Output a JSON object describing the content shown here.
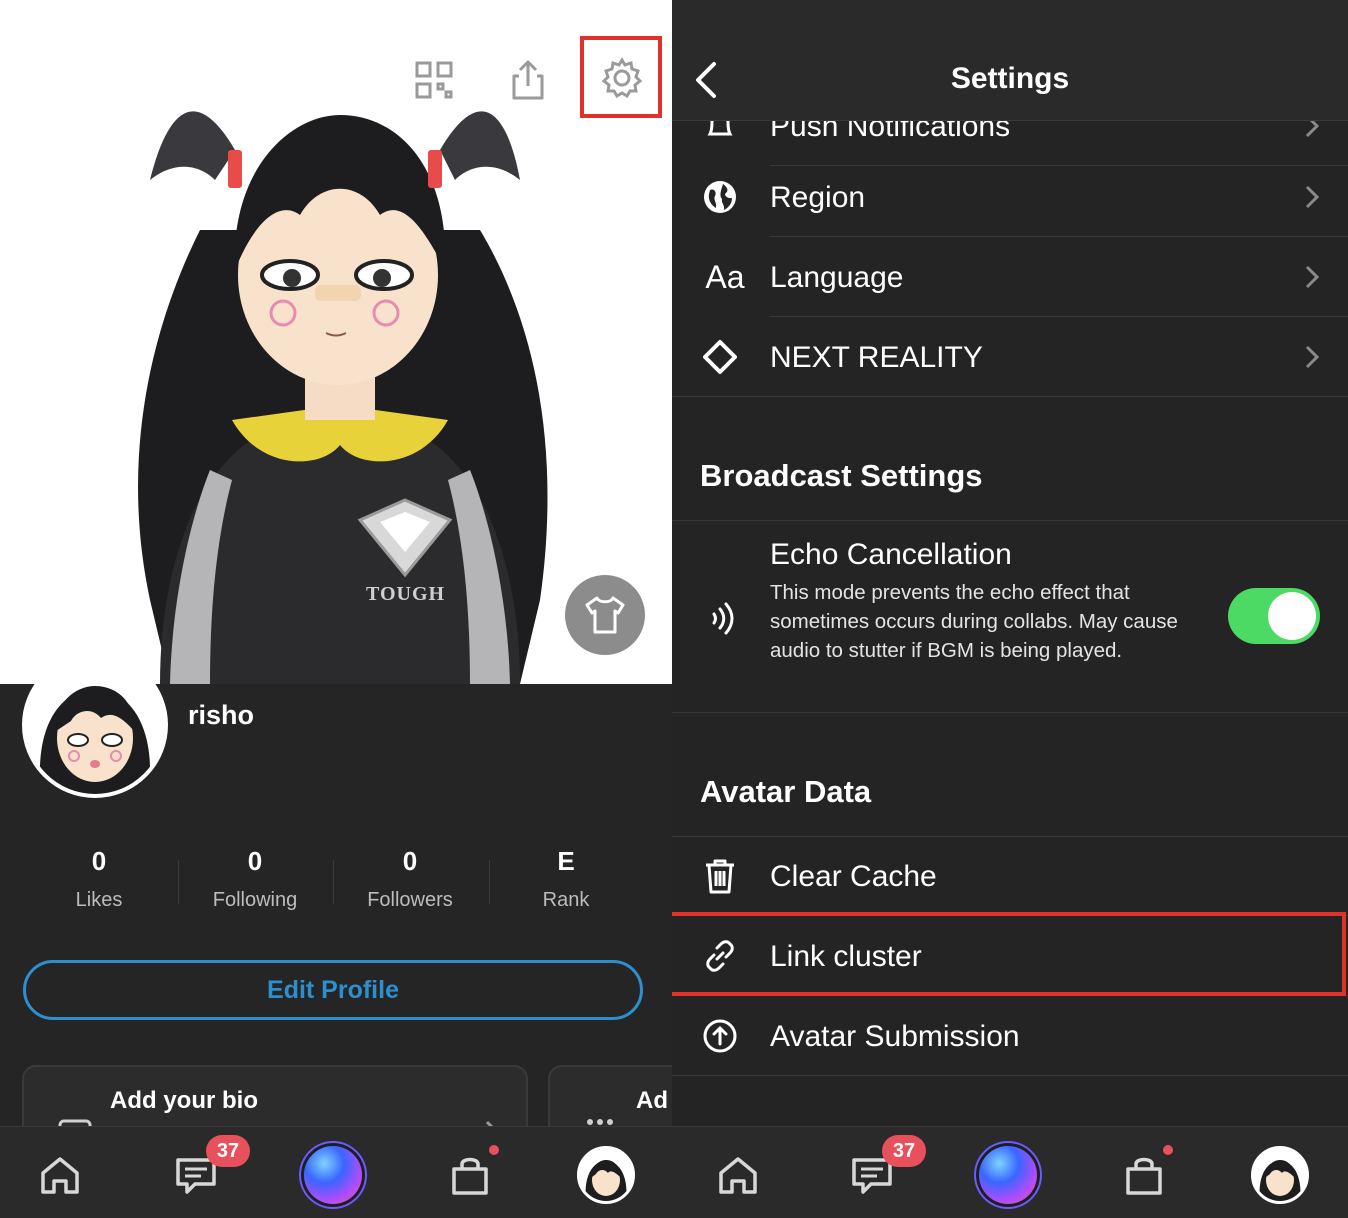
{
  "left": {
    "top_icons": [
      "qr-code-icon",
      "share-icon",
      "gear-icon"
    ],
    "avatar_shirt_text": "TOUGH",
    "profile": {
      "username": "risho",
      "stats": [
        {
          "value": "0",
          "label": "Likes"
        },
        {
          "value": "0",
          "label": "Following"
        },
        {
          "value": "0",
          "label": "Followers"
        },
        {
          "value": "E",
          "label": "Rank"
        }
      ],
      "edit_button": "Edit Profile",
      "bio_cards": [
        {
          "title": "Add your bio"
        },
        {
          "title": "Ad"
        }
      ]
    }
  },
  "tabbar": {
    "items": [
      "home-icon",
      "messages-icon",
      "create-orb",
      "shop-icon",
      "profile-avatar"
    ],
    "messages_badge": "37"
  },
  "settings": {
    "title": "Settings",
    "rows_top": [
      {
        "label": "Push Notifications",
        "icon": "bell-icon"
      },
      {
        "label": "Region",
        "icon": "globe-icon"
      },
      {
        "label": "Language",
        "icon": "font-icon",
        "icon_text": "Aa"
      },
      {
        "label": "NEXT REALITY",
        "icon": "diamond-icon"
      }
    ],
    "broadcast": {
      "title": "Broadcast Settings",
      "echo_title": "Echo Cancellation",
      "echo_desc": "This mode prevents the echo effect that sometimes occurs during collabs. May cause audio to stutter if BGM is being played.",
      "echo_enabled": true
    },
    "avatar_data": {
      "title": "Avatar Data",
      "rows": [
        {
          "label": "Clear Cache",
          "icon": "trash-icon"
        },
        {
          "label": "Link cluster",
          "icon": "link-icon"
        },
        {
          "label": "Avatar Submission",
          "icon": "upload-icon"
        }
      ]
    }
  },
  "colors": {
    "accent_blue": "#2d8fd0",
    "toggle_on": "#4cd964",
    "highlight_red": "#e0312b",
    "badge_red": "#e8505b"
  }
}
